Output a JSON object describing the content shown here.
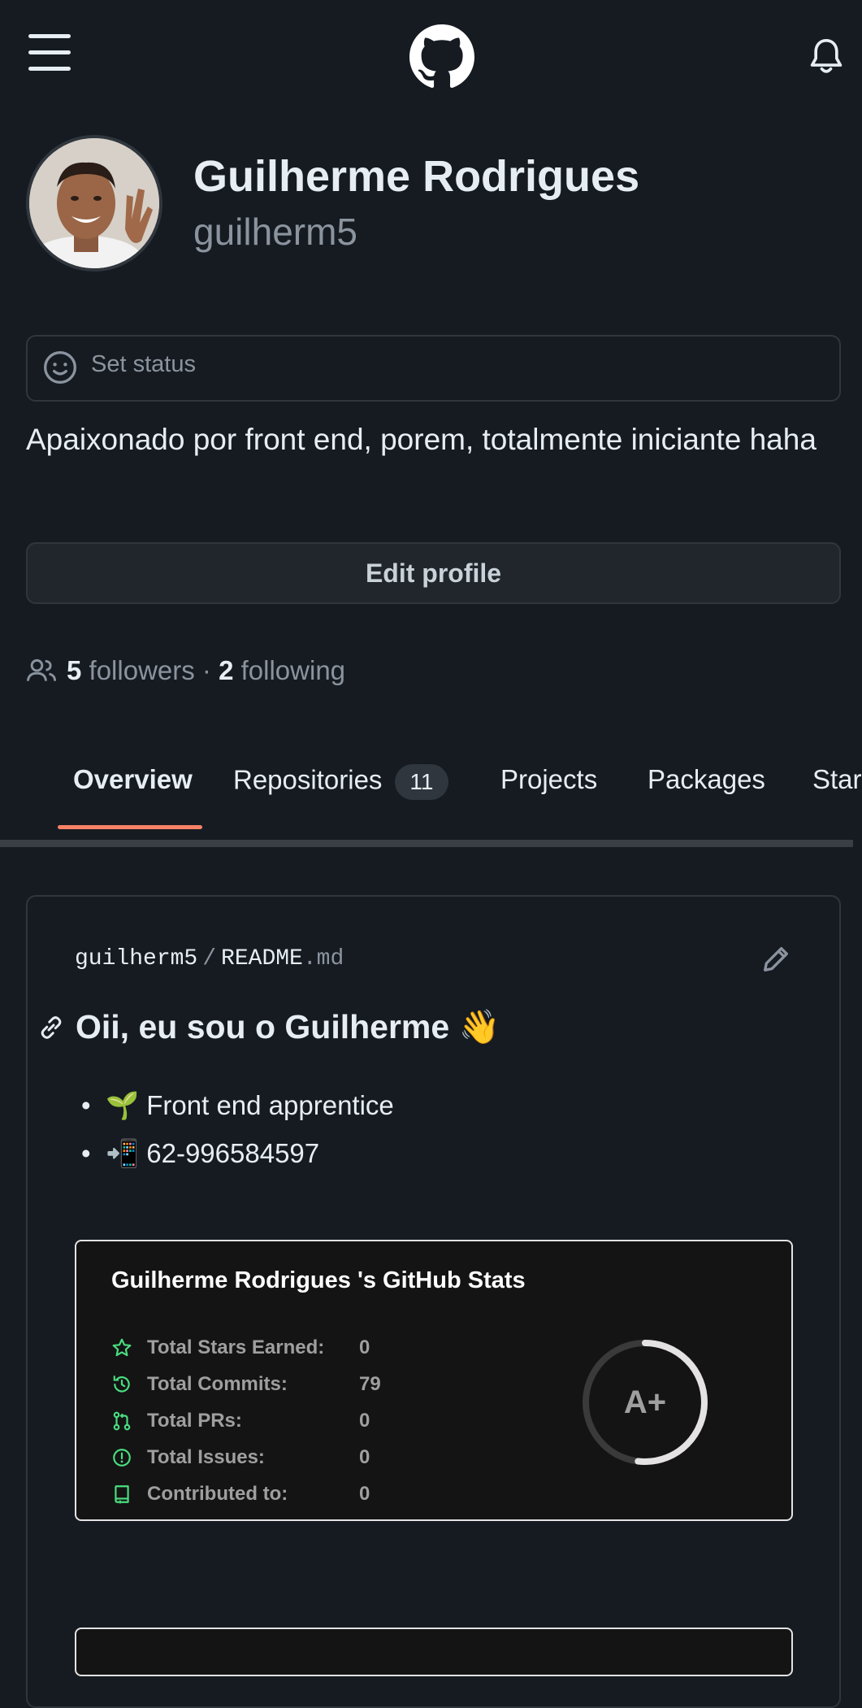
{
  "header": {
    "menu_icon": "hamburger-icon",
    "logo_icon": "github-logo",
    "notification_icon": "bell-icon"
  },
  "profile": {
    "name": "Guilherme Rodrigues",
    "login": "guilherm5",
    "status_placeholder": "Set status",
    "bio": "Apaixonado por front end, porem, totalmente iniciante haha",
    "edit_label": "Edit profile",
    "followers_count": "5",
    "followers_label": "followers",
    "separator": "·",
    "following_count": "2",
    "following_label": "following"
  },
  "tabs": [
    {
      "label": "Overview",
      "active": true
    },
    {
      "label": "Repositories",
      "count": "11"
    },
    {
      "label": "Projects"
    },
    {
      "label": "Packages"
    },
    {
      "label": "Stars"
    }
  ],
  "readme": {
    "owner": "guilherm5",
    "slash": "/",
    "file_base": "README",
    "file_ext": ".md",
    "heading": "Oii, eu sou o Guilherme 👋",
    "items": [
      "🌱 Front end apprentice",
      "📲 62-996584597"
    ]
  },
  "stats_card": {
    "title": "Guilherme Rodrigues 's GitHub Stats",
    "rows": [
      {
        "label": "Total Stars Earned:",
        "value": "0",
        "icon": "star-icon"
      },
      {
        "label": "Total Commits:",
        "value": "79",
        "icon": "history-icon"
      },
      {
        "label": "Total PRs:",
        "value": "0",
        "icon": "pull-request-icon"
      },
      {
        "label": "Total Issues:",
        "value": "0",
        "icon": "issue-icon"
      },
      {
        "label": "Contributed to:",
        "value": "0",
        "icon": "repo-icon"
      }
    ],
    "grade": "A+",
    "accent": "#4ade80",
    "ring_color": "#e4e2e2"
  },
  "colors": {
    "background": "#161b22",
    "border": "#30363d",
    "tab_underline": "#f78166",
    "muted_text": "#8b949e"
  }
}
